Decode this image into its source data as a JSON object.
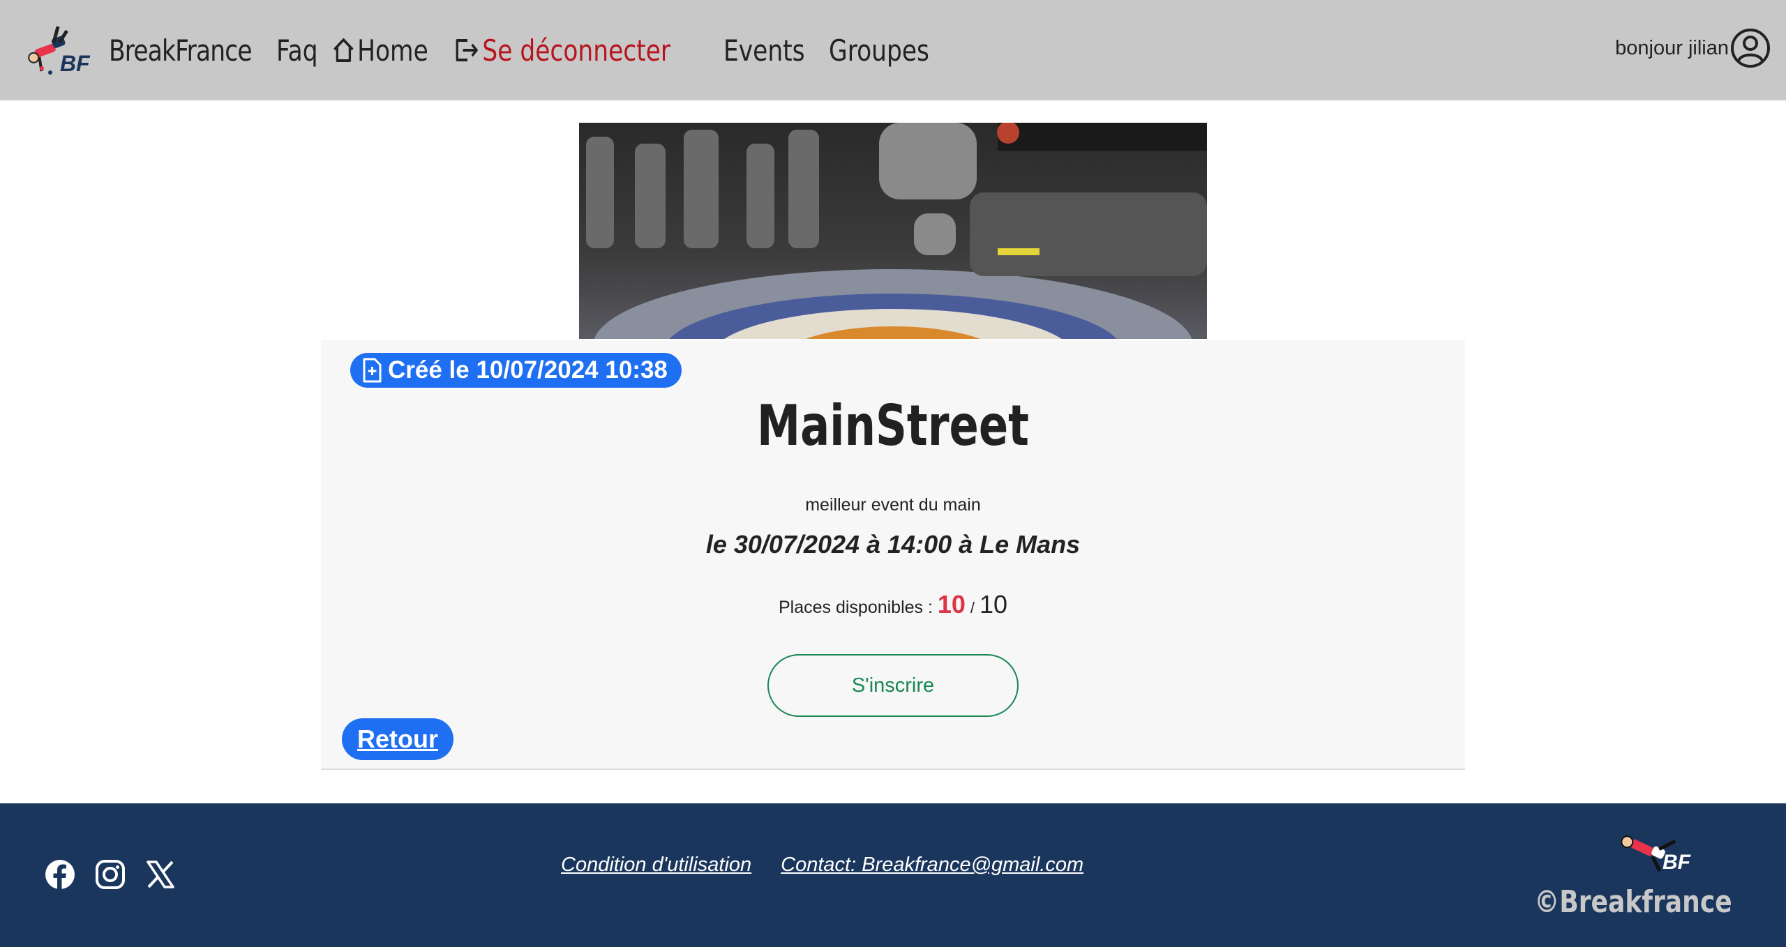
{
  "nav": {
    "brand": "BreakFrance",
    "logo_text": "BF",
    "links": {
      "faq": "Faq",
      "home": "Home",
      "logout": "Se déconnecter",
      "events": "Events",
      "groups": "Groupes"
    },
    "greeting": "bonjour jilian",
    "logout_color": "#b8141e"
  },
  "event": {
    "created": "Créé le 10/07/2024 10:38",
    "title": "MainStreet",
    "description": "meilleur event du main",
    "date_line": "le 30/07/2024 à 14:00 à Le Mans",
    "places_label": "Places disponibles :",
    "places_available": "10",
    "places_separator": "/",
    "places_total": "10",
    "signup_label": "S'inscrire",
    "back_label": "Retour"
  },
  "footer": {
    "terms": "Condition d'utilisation",
    "contact": "Contact: Breakfrance@gmail.com",
    "logo_text": "BF",
    "copyright": "©Breakfrance",
    "social_icons": [
      "facebook-icon",
      "instagram-icon",
      "x-icon"
    ]
  },
  "colors": {
    "navbar_bg": "#c8c8c8",
    "badge_blue": "#1f6ff2",
    "available_red": "#dc3545",
    "signup_green": "#198754",
    "footer_bg": "#1b365d"
  }
}
